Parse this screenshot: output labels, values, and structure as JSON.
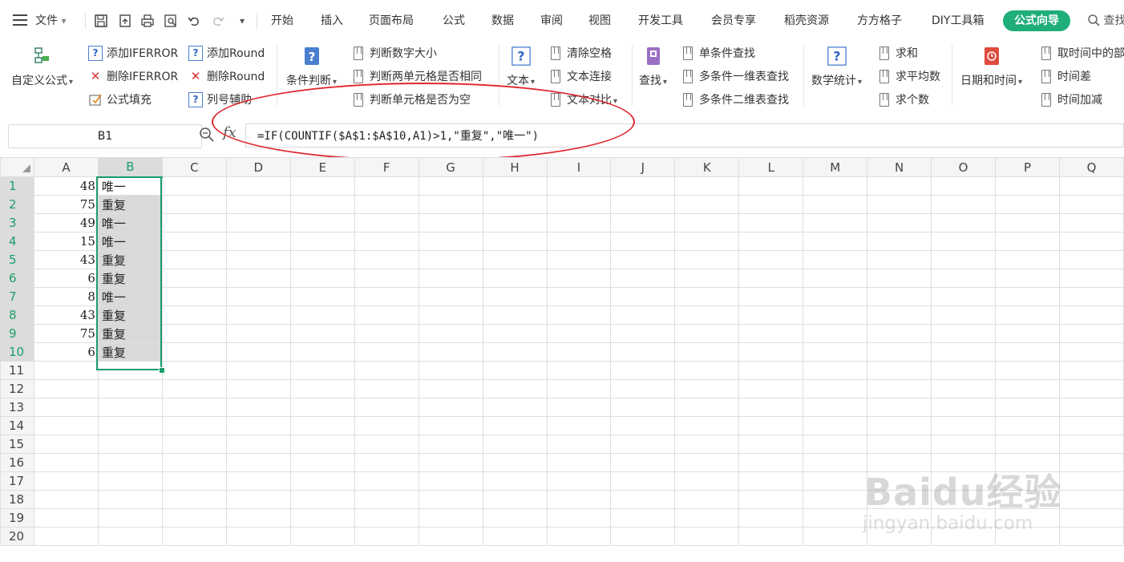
{
  "menubar": {
    "file_label": "文件",
    "tabs": [
      {
        "label": "开始"
      },
      {
        "label": "插入"
      },
      {
        "label": "页面布局"
      },
      {
        "label": "公式"
      },
      {
        "label": "数据"
      },
      {
        "label": "审阅"
      },
      {
        "label": "视图"
      },
      {
        "label": "开发工具"
      },
      {
        "label": "会员专享"
      },
      {
        "label": "稻壳资源"
      },
      {
        "label": "方方格子"
      },
      {
        "label": "DIY工具箱"
      },
      {
        "label": "公式向导"
      }
    ],
    "search_label": "查找",
    "active_tab_color": "#1fae7a"
  },
  "ribbon": {
    "custom_formula": "自定义公式",
    "add_iferror": "添加IFERROR",
    "del_iferror": "删除IFERROR",
    "formula_fill": "公式填充",
    "add_round": "添加Round",
    "del_round": "删除Round",
    "col_helper": "列号辅助",
    "cond_judge": "条件判断",
    "judge_num_size": "判断数字大小",
    "judge_two_same": "判断两单元格是否相同",
    "judge_empty": "判断单元格是否为空",
    "text": "文本",
    "clear_space": "清除空格",
    "text_join": "文本连接",
    "text_compare": "文本对比",
    "lookup": "查找",
    "single_cond_lookup": "单条件查找",
    "multi_cond_1d": "多条件一维表查找",
    "multi_cond_2d": "多条件二维表查找",
    "math_stats": "数学统计",
    "sum": "求和",
    "average": "求平均数",
    "count": "求个数",
    "date_time": "日期和时间",
    "extract_time": "取时间中的部",
    "time_diff": "时间差",
    "time_add": "时间加减"
  },
  "formula_bar": {
    "name_box": "B1",
    "fx": "fx",
    "formula": "=IF(COUNTIF($A$1:$A$10,A1)>1,\"重复\",\"唯一\")"
  },
  "grid": {
    "columns": [
      "A",
      "B",
      "C",
      "D",
      "E",
      "F",
      "G",
      "H",
      "I",
      "J",
      "K",
      "L",
      "M",
      "N",
      "O",
      "P",
      "Q"
    ],
    "rows": [
      {
        "n": "1",
        "a": "48",
        "b": "唯一"
      },
      {
        "n": "2",
        "a": "75",
        "b": "重复"
      },
      {
        "n": "3",
        "a": "49",
        "b": "唯一"
      },
      {
        "n": "4",
        "a": "15",
        "b": "唯一"
      },
      {
        "n": "5",
        "a": "43",
        "b": "重复"
      },
      {
        "n": "6",
        "a": "6",
        "b": "重复"
      },
      {
        "n": "7",
        "a": "8",
        "b": "唯一"
      },
      {
        "n": "8",
        "a": "43",
        "b": "重复"
      },
      {
        "n": "9",
        "a": "75",
        "b": "重复"
      },
      {
        "n": "10",
        "a": "6",
        "b": "重复"
      },
      {
        "n": "11"
      },
      {
        "n": "12"
      },
      {
        "n": "13"
      },
      {
        "n": "14"
      },
      {
        "n": "15"
      },
      {
        "n": "16"
      },
      {
        "n": "17"
      },
      {
        "n": "18"
      },
      {
        "n": "19"
      },
      {
        "n": "20"
      }
    ],
    "selection_color": "#1a9e6a"
  },
  "watermark": {
    "main": "Baidu经验",
    "sub": "jingyan.baidu.com"
  },
  "annotation_color": "#e0262c"
}
